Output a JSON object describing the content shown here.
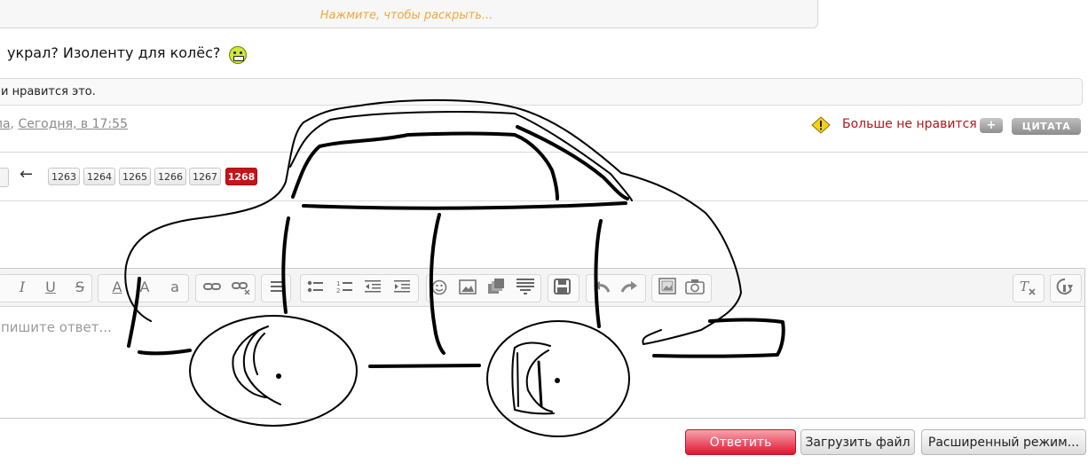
{
  "quote": {
    "expand_label": "Нажмите, чтобы раскрыть..."
  },
  "post": {
    "text": "украл? Изоленту для колёс?",
    "smiley_icon": "green-grin-smiley-icon",
    "likes_text": "и нравится это.",
    "author": "ла",
    "date": "Сегодня, в 17:55",
    "unlike_label": "Больше не нравится",
    "plus_label": "+",
    "quote_label": "ЦИТАТА"
  },
  "pagination": {
    "prev_arrow": "←",
    "pages": [
      "1263",
      "1264",
      "1265",
      "1266",
      "1267",
      "1268"
    ],
    "current": "1268"
  },
  "editor": {
    "placeholder": "пишите ответ...",
    "toolbar": {
      "italic": "I",
      "underline": "U",
      "strike": "S",
      "font_color": "A",
      "font_size": "A",
      "font_family": "a",
      "link": "🔗",
      "unlink": "⛓",
      "align": "≡",
      "bullets": "•≡",
      "numbers": "1≡",
      "outdent": "⇤",
      "indent": "⇥",
      "smilies": "☺",
      "image": "▣",
      "media": "◧",
      "code": "≣",
      "save": "💾",
      "undo": "↶",
      "redo": "↷",
      "insert_image": "▨",
      "camera": "📷",
      "remove_format": "Tx",
      "toggle_bbcode": "⚙"
    }
  },
  "buttons": {
    "reply": "Ответить",
    "upload": "Загрузить файл",
    "advanced": "Расширенный режим..."
  },
  "colors": {
    "accent_red": "#c8121a",
    "unlike_red": "#b3161a",
    "expand_orange": "#f2a63a"
  }
}
